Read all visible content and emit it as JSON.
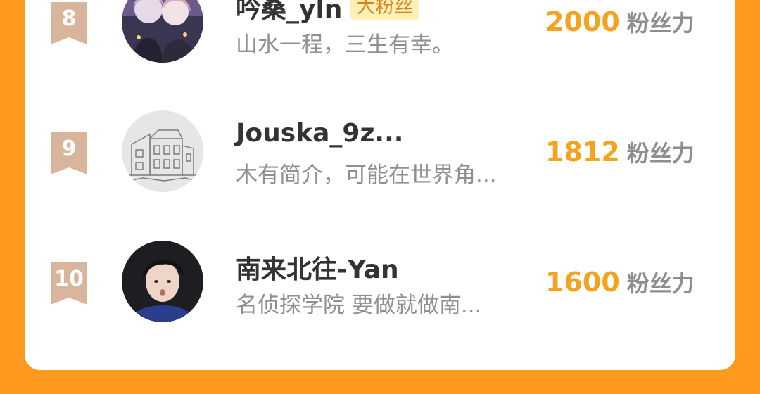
{
  "colors": {
    "page_background": "#FF9A1F",
    "card_background": "#FFFFFF",
    "rank_ribbon": "#D8B59B",
    "score": "#F5A21E",
    "name": "#333333",
    "bio": "#8F8F8F",
    "unit": "#8E8E8E",
    "badge_background": "#FFF0B8",
    "badge_text": "#D9841B"
  },
  "ranking": [
    {
      "rank": "8",
      "name": "吟桑_yln",
      "badge": "大粉丝",
      "bio": "山水一程，三生有幸。",
      "score": "2000",
      "unit": "粉丝力",
      "avatar_icon": "anime-couple-avatar"
    },
    {
      "rank": "9",
      "name": "Jouska_9z...",
      "badge": "",
      "bio": "木有简介，可能在世界角...",
      "score": "1812",
      "unit": "粉丝力",
      "avatar_icon": "building-sketch-avatar"
    },
    {
      "rank": "10",
      "name": "南来北往-Yan",
      "badge": "",
      "bio": "名侦探学院 要做就做南...",
      "score": "1600",
      "unit": "粉丝力",
      "avatar_icon": "person-photo-avatar"
    }
  ]
}
